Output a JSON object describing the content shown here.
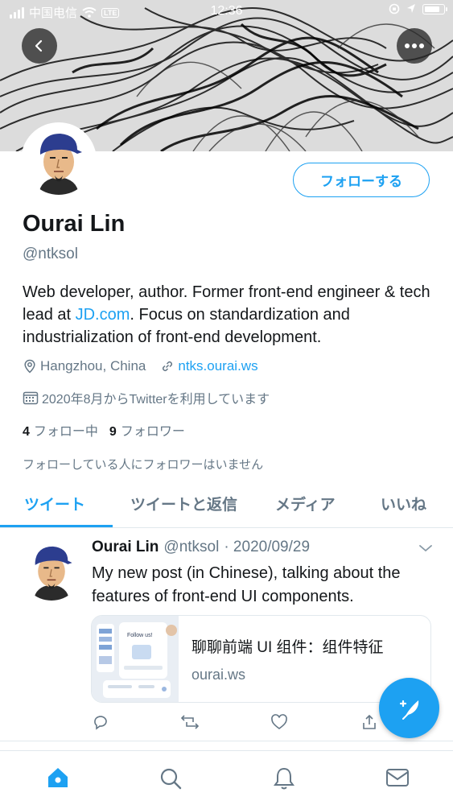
{
  "status_bar": {
    "carrier": "中国电信",
    "network": "LTE",
    "time": "12:36",
    "battery_level": 0.85
  },
  "banner": {
    "back_icon": "chevron-left-icon",
    "more_icon": "more-dots-icon"
  },
  "profile": {
    "name": "Ourai Lin",
    "handle": "@ntksol",
    "follow_label": "フォローする",
    "bio_part1": "Web developer, author. Former front-end engineer & tech lead at ",
    "bio_link": "JD.com",
    "bio_part2": ". Focus on standardization and industrialization of front-end development.",
    "location": "Hangzhou, China",
    "website": "ntks.ourai.ws",
    "joined": "2020年8月からTwitterを利用しています",
    "following_count": "4",
    "following_label": "フォロー中",
    "followers_count": "9",
    "followers_label": "フォロワー",
    "mutual_note": "フォローしている人にフォロワーはいません"
  },
  "tabs": [
    {
      "label": "ツイート"
    },
    {
      "label": "ツイートと返信"
    },
    {
      "label": "メディア"
    },
    {
      "label": "いいね"
    }
  ],
  "tweet": {
    "name": "Ourai Lin",
    "handle": "@ntksol",
    "date": "· 2020/09/29",
    "text": "My new post (in Chinese), talking about the features of front-end UI components.",
    "card_title": "聊聊前端 UI 组件：组件特征",
    "card_domain": "ourai.ws",
    "card_thumb_text": "Follow us!"
  },
  "fab": {
    "icon": "compose-tweet-icon"
  },
  "nav": [
    {
      "icon": "home-icon"
    },
    {
      "icon": "search-icon"
    },
    {
      "icon": "bell-icon"
    },
    {
      "icon": "mail-icon"
    }
  ],
  "colors": {
    "accent": "#1da1f2",
    "secondary_text": "#657786",
    "border": "#e1e8ed"
  }
}
